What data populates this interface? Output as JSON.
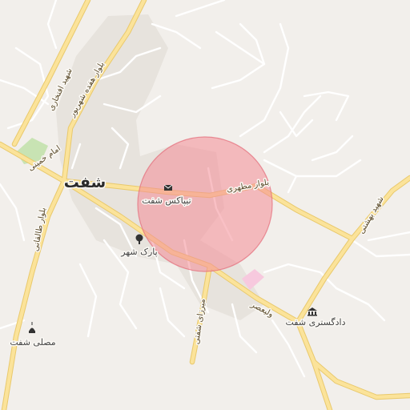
{
  "map": {
    "city_name": "شفت",
    "roads": {
      "motahari": "بلوار مطهری",
      "imam_khomeini": "امام خمینی",
      "taleghani": "بلوار طالقانی",
      "hefdah_shahrivar": "بلوار هفده شهریور",
      "shahid_eftekhari": "شهید افتخاری",
      "shahid_beheshti": "شهید بهشتی",
      "mirzaye_shafti": "میرزای شفتی",
      "valiasr": "ولیعصر"
    },
    "pois": {
      "tipax": "تیپاکس شفت",
      "park": "پارک شهر",
      "court": "دادگستری شفت",
      "mosalla": "مصلی شفت"
    },
    "icons": {
      "tipax": "mail-icon",
      "park": "tree-icon",
      "court": "courthouse-icon",
      "mosalla": "mosque-icon"
    },
    "colors": {
      "background": "#f2efeb",
      "major_road": "#fbe39a",
      "major_road_casing": "#e9c96c",
      "minor_road": "#ffffff",
      "highlight_circle_fill": "#f48c96",
      "highlight_circle_stroke": "#e46a78",
      "park_green": "#c8e3b3",
      "pink_area": "#f7c9de"
    }
  }
}
